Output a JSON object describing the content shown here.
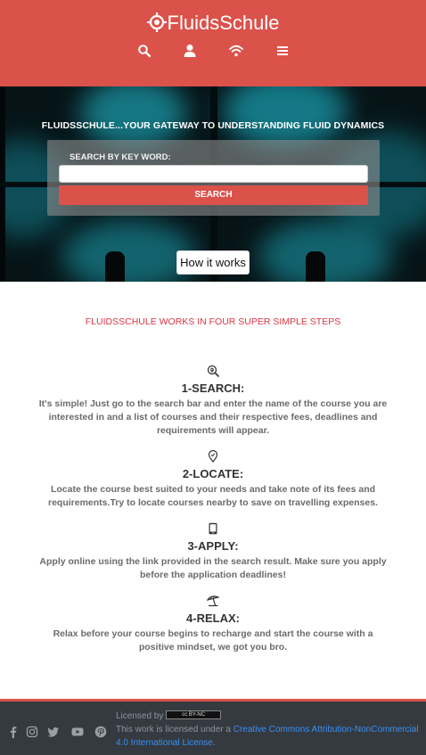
{
  "header": {
    "brand": "FluidsSchule",
    "background_color": "#db524b",
    "logo_icon": "crosshair-icon",
    "nav_icons": [
      "search-icon",
      "user-icon",
      "wifi-icon",
      "menu-icon"
    ]
  },
  "hero": {
    "title": "FLUIDSSCHULE...YOUR GATEWAY TO UNDERSTANDING FLUID DYNAMICS",
    "search_label": "SEARCH BY KEY WORD:",
    "search_value": "",
    "search_button": "SEARCH",
    "how_it_works_button": "How it works"
  },
  "main": {
    "section_title": "FLUIDSSCHULE WORKS IN FOUR SUPER SIMPLE STEPS",
    "steps": [
      {
        "icon": "search-location-icon",
        "title": "1-SEARCH:",
        "text": "It's simple! Just go to the search bar and enter the name of the course you are interested in and a list of courses and their respective fees, deadlines and requirements will appear."
      },
      {
        "icon": "map-pin-icon",
        "title": "2-LOCATE:",
        "text": "Locate the course best suited to your needs and take note of its fees and requirements.Try to locate courses nearby to save on travelling expenses."
      },
      {
        "icon": "tablet-icon",
        "title": "3-APPLY:",
        "text": "Apply online using the link provided in the search result. Make sure you apply before the application deadlines!"
      },
      {
        "icon": "beach-umbrella-icon",
        "title": "4-RELAX:",
        "text": "Relax before your course begins to recharge and start the course with a positive mindset, we got you bro."
      }
    ]
  },
  "footer": {
    "social_icons": [
      "facebook-icon",
      "instagram-icon",
      "twitter-icon",
      "youtube-icon",
      "pinterest-icon"
    ],
    "licensed_by": "Licensed by",
    "cc_badge_text": "cc BY-NC",
    "license_prefix": "This work is licensed under a ",
    "license_link": "Creative Commons Attribution-NonCommercial 4.0 International License",
    "license_suffix": "."
  }
}
